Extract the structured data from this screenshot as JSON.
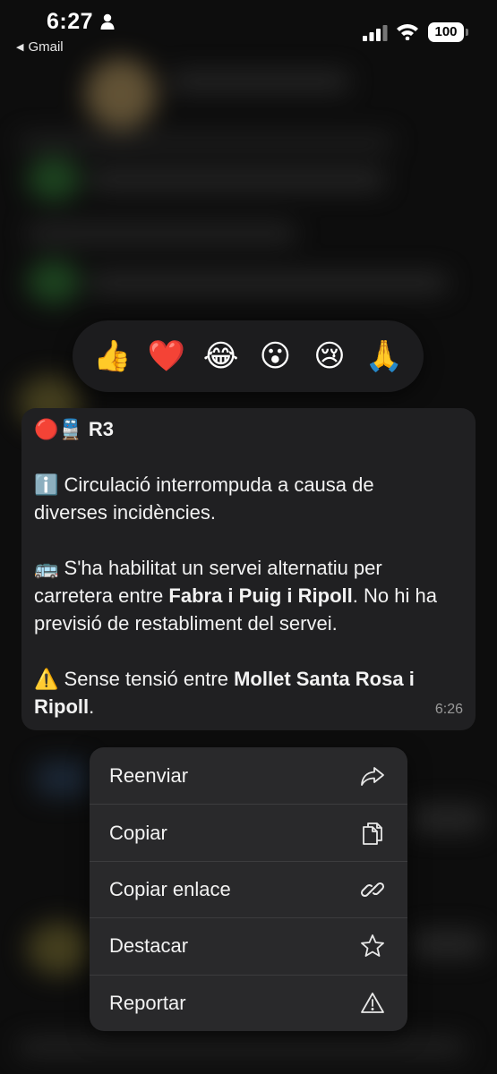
{
  "status_bar": {
    "time": "6:27",
    "back_label": "Gmail",
    "battery": "100"
  },
  "reactions": [
    "👍",
    "❤️",
    "😂",
    "😮",
    "😢",
    "🙏"
  ],
  "message": {
    "line1_emoji": "🔴🚆",
    "line1_text": "R3",
    "para1_emoji": "ℹ️",
    "para1_l1": "Circulació interrompuda a causa de",
    "para1_l2": "diverses incidències.",
    "para2_emoji": "🚌",
    "para2_l1": "S'ha habilitat un servei alternatiu per",
    "para2_l2_a": "carretera entre ",
    "para2_l2_b": "Fabra i Puig i Ripoll",
    "para2_l2_c": ". No hi ha",
    "para2_l3": "previsió de restabliment del servei.",
    "para3_emoji": "⚠️",
    "para3_l1_a": " Sense tensió entre ",
    "para3_l1_b": "Mollet Santa Rosa i",
    "para3_l2_b": "Ripoll",
    "para3_l2_c": ".",
    "time": "6:26"
  },
  "menu": {
    "items": [
      {
        "label": "Reenviar",
        "icon": "forward-icon"
      },
      {
        "label": "Copiar",
        "icon": "copy-icon"
      },
      {
        "label": "Copiar enlace",
        "icon": "link-icon"
      },
      {
        "label": "Destacar",
        "icon": "star-icon"
      },
      {
        "label": "Reportar",
        "icon": "warning-icon"
      }
    ]
  }
}
